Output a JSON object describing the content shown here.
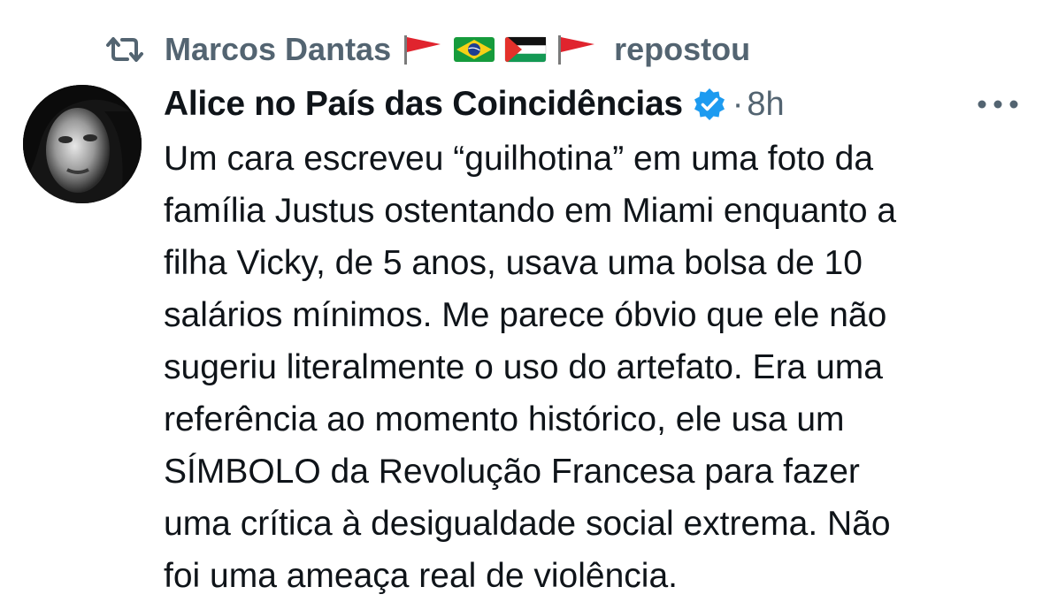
{
  "repost": {
    "icon": "repost-icon",
    "name": "Marcos Dantas",
    "flags": [
      "red-flag",
      "brazil-flag",
      "palestine-flag",
      "red-flag"
    ],
    "suffix": "repostou"
  },
  "tweet": {
    "avatar": "avatar-image",
    "author": "Alice no País das Coincidências",
    "verified_icon": "verified-badge-icon",
    "separator": "·",
    "time": "8h",
    "more_icon": "more-options-icon",
    "lines": [
      "Um cara escreveu “guilhotina” em uma foto da",
      "família Justus ostentando em Miami enquanto a",
      "filha Vicky, de 5 anos, usava uma bolsa de 10",
      "salários mínimos. Me parece óbvio que ele não",
      "sugeriu literalmente o uso do artefato. Era uma",
      "referência ao momento histórico, ele usa um",
      "SÍMBOLO da Revolução Francesa para fazer",
      "uma crítica à desigualdade social extrema. Não",
      "foi uma ameaça real de violência."
    ]
  },
  "colors": {
    "text": "#0f1419",
    "secondary": "#536471",
    "verified": "#1d9bf0",
    "background": "#ffffff"
  }
}
